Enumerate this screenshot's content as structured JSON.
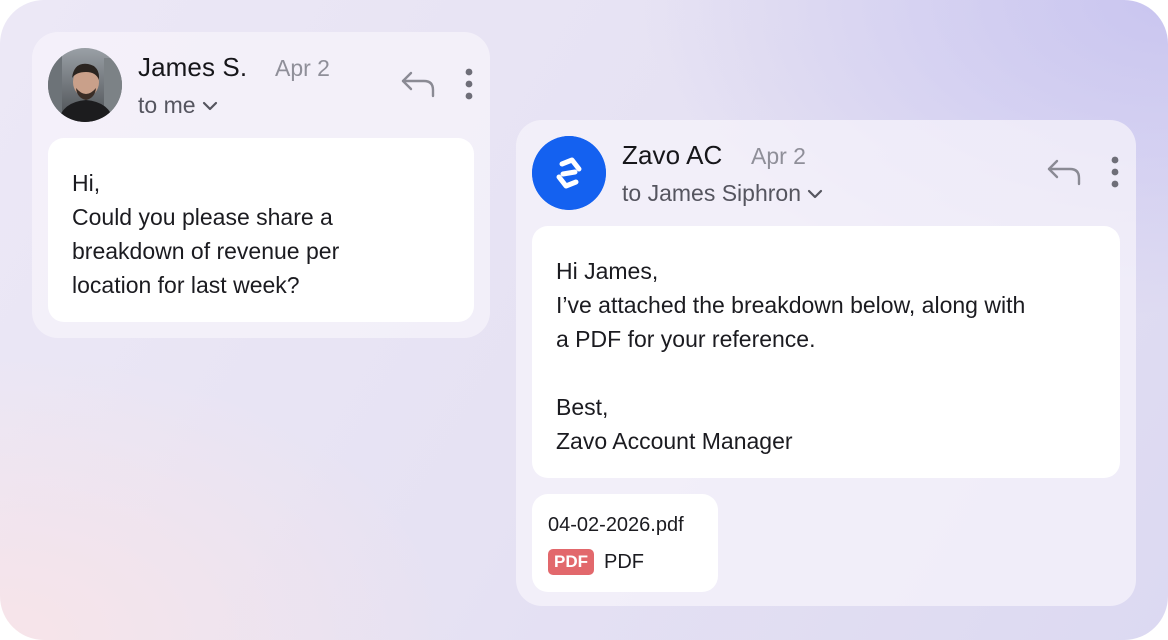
{
  "messages": [
    {
      "sender": "James S.",
      "date": "Apr 2",
      "recipient": "to me",
      "body": [
        "Hi,",
        "Could you please share a",
        "breakdown of revenue per",
        "location for last week?"
      ]
    },
    {
      "sender": "Zavo AC",
      "date": "Apr 2",
      "recipient": "to James Siphron",
      "body": [
        "Hi James,",
        "I’ve attached the breakdown below, along with",
        "a PDF for your reference.",
        "",
        "Best,",
        "Zavo Account Manager"
      ],
      "attachment": {
        "filename": "04-02-2026.pdf",
        "badge": "PDF",
        "type_label": "PDF"
      }
    }
  ],
  "icons": {
    "reply": "reply-arrow-icon",
    "more": "vertical-ellipsis-icon",
    "chevron": "chevron-down-icon",
    "brand_logo": "zavo-logo-icon"
  },
  "colors": {
    "brand_blue": "#1461f0",
    "pdf_badge": "#e2686c"
  }
}
